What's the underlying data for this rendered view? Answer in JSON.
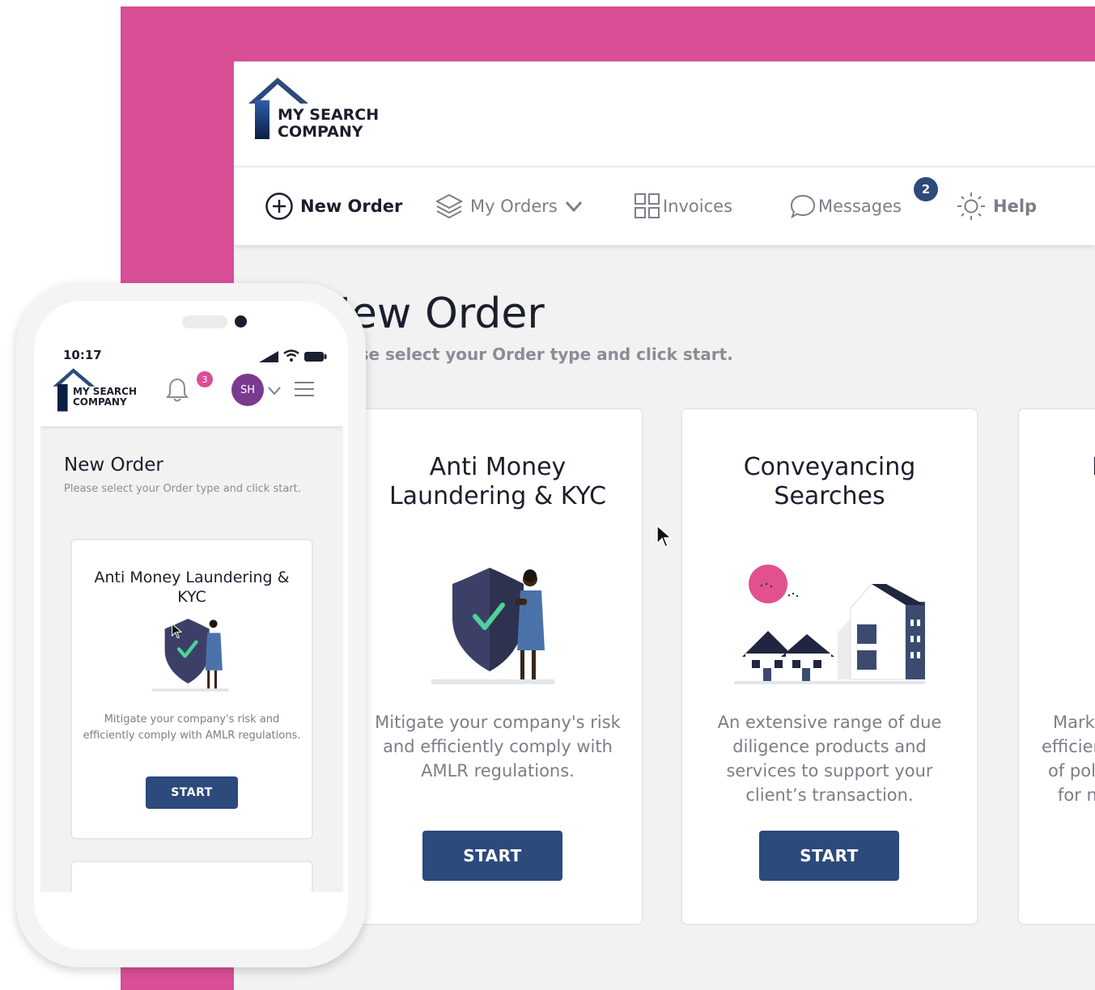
{
  "brand": {
    "line1": "MY SEARCH",
    "line2": "COMPANY"
  },
  "nav": {
    "new_order": "New Order",
    "my_orders": "My Orders",
    "invoices": "Invoices",
    "messages": "Messages",
    "messages_count": "2",
    "help": "Help"
  },
  "page": {
    "title": "New Order",
    "subtitle": "Please select your Order type and click start."
  },
  "cards": [
    {
      "title_line1": "Anti Money",
      "title_line2": "Laundering & KYC",
      "desc": [
        "Mitigate your company's risk",
        "and efficiently comply with",
        "AMLR regulations."
      ],
      "button": "START"
    },
    {
      "title_line1": "Conveyancing",
      "title_line2": "Searches",
      "desc": [
        "An extensive range of due",
        "diligence products and",
        "services to support your",
        "client’s transaction."
      ],
      "button": "START"
    },
    {
      "title_line1": "I",
      "desc": [
        "Mark",
        "efficier",
        "of pol",
        "for n"
      ]
    }
  ],
  "mobile": {
    "time": "10:17",
    "notifications_count": "3",
    "avatar_initials": "SH",
    "title": "New Order",
    "subtitle": "Please select your Order type and click start.",
    "card": {
      "title": "Anti Money Laundering & KYC",
      "desc": "Mitigate your company's risk and efficiently comply with AMLR regulations.",
      "button": "START"
    }
  },
  "colors": {
    "pink": "#d94f96",
    "navy": "#2c4a7b",
    "ink": "#1b1e2c",
    "muted": "#7b7e88",
    "avatar": "#7a3b8f"
  },
  "icons": [
    "house-logo-icon",
    "plus-circle-icon",
    "layers-icon",
    "chevron-down-icon",
    "grid-icon",
    "chat-bubble-icon",
    "sun-icon",
    "bell-icon",
    "hamburger-icon",
    "signal-icon",
    "wifi-icon",
    "battery-icon",
    "cursor-icon"
  ]
}
